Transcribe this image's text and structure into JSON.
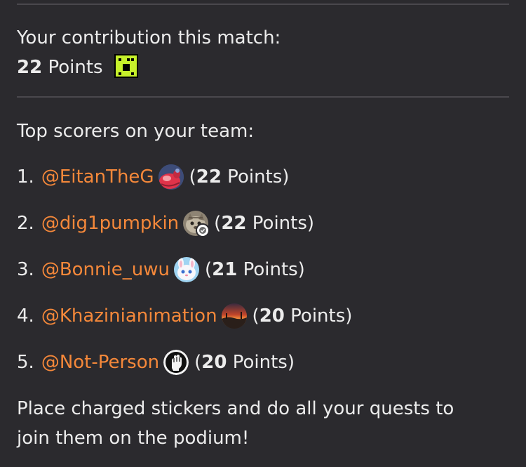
{
  "contribution": {
    "heading": "Your contribution this match:",
    "points_value": "22",
    "points_unit": "Points",
    "icon": "pixel-smiley-icon"
  },
  "top_scorers": {
    "heading": "Top scorers on your team:",
    "items": [
      {
        "rank": "1.",
        "handle": "@EitanTheG",
        "open": "(",
        "points": "22",
        "unit": " Points)",
        "avatar": "red-character-avatar"
      },
      {
        "rank": "2.",
        "handle": "@dig1pumpkin",
        "open": "(",
        "points": "22",
        "unit": " Points)",
        "avatar": "tabby-cat-avatar"
      },
      {
        "rank": "3.",
        "handle": "@Bonnie_uwu",
        "open": "(",
        "points": "21",
        "unit": " Points)",
        "avatar": "white-bunny-avatar"
      },
      {
        "rank": "4.",
        "handle": "@Khazinianimation",
        "open": "(",
        "points": "20",
        "unit": " Points)",
        "avatar": "sunset-avatar"
      },
      {
        "rank": "5.",
        "handle": "@Not-Person",
        "open": "(",
        "points": "20",
        "unit": " Points)",
        "avatar": "raised-fist-avatar"
      }
    ]
  },
  "footer": {
    "line1": "Place charged stickers and do all your quests to",
    "line2": "join them on the podium!"
  },
  "colors": {
    "background": "#2b2a2e",
    "text": "#ececec",
    "mention": "#f5883a",
    "divider": "#4a484d",
    "icon_green": "#c6f02b"
  }
}
